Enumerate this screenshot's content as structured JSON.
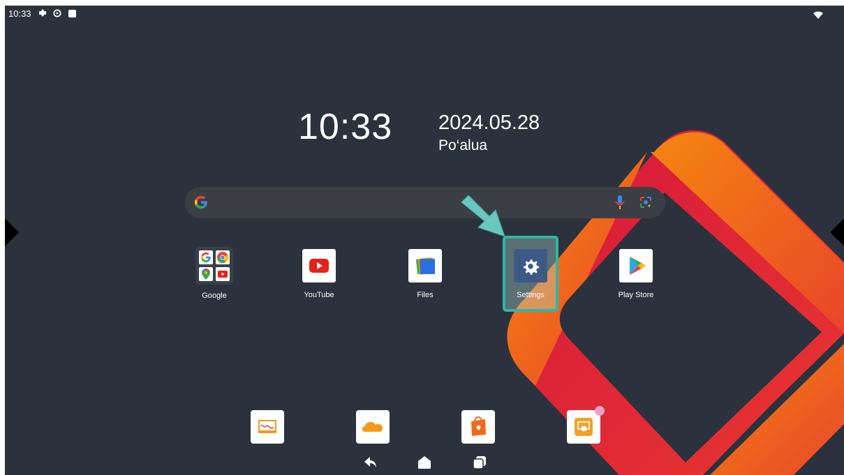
{
  "status_bar": {
    "time": "10:33",
    "icons": [
      "settings-gear-icon",
      "settings-dial-icon",
      "square-notification-icon"
    ],
    "right_icons": [
      "wifi-icon"
    ]
  },
  "clock_widget": {
    "time": "10:33",
    "date": "2024.05.28",
    "weekday": "Po‘alua"
  },
  "search_bar": {
    "icons": [
      "google-g-icon",
      "microphone-icon",
      "google-lens-icon"
    ]
  },
  "apps": [
    {
      "label": "Google",
      "icon": "google-folder-icon"
    },
    {
      "label": "YouTube",
      "icon": "youtube-icon"
    },
    {
      "label": "Files",
      "icon": "files-icon"
    },
    {
      "label": "Settings",
      "icon": "settings-gear-icon"
    },
    {
      "label": "Play Store",
      "icon": "play-store-icon"
    }
  ],
  "dock": [
    {
      "icon": "whiteboard-icon"
    },
    {
      "icon": "cloud-icon"
    },
    {
      "icon": "app-store-bag-icon"
    },
    {
      "icon": "screen-share-icon"
    }
  ],
  "nav_bar": [
    "back-icon",
    "home-icon",
    "recents-icon"
  ],
  "colors": {
    "background": "#2c323d",
    "accent_orange": "#f27a1a",
    "accent_red": "#d6183f",
    "highlight": "#2fb6a4",
    "settings_tile": "#3d5a86"
  }
}
